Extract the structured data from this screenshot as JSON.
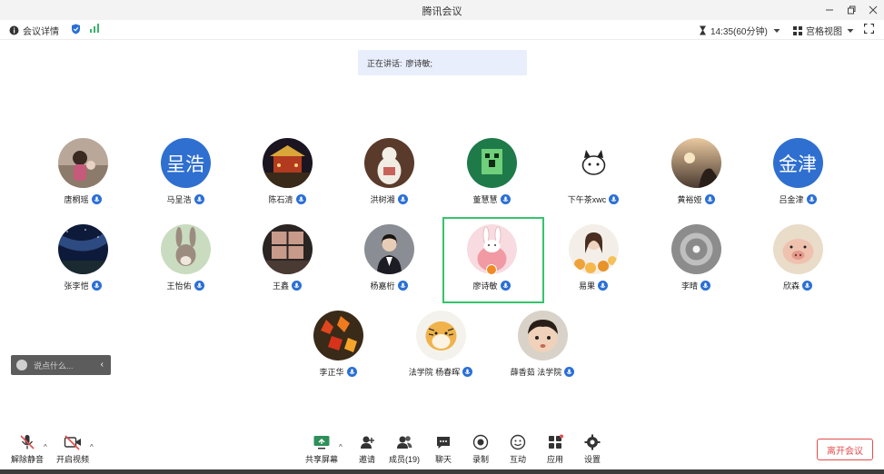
{
  "window": {
    "title": "腾讯会议"
  },
  "infobar": {
    "meeting_info": "会议详情",
    "time": "14:35(60分钟)",
    "view_mode": "宫格视图"
  },
  "speaking": {
    "label": "正在讲话:",
    "name": "廖诗敏;"
  },
  "participants": [
    {
      "name": "唐桐瑶",
      "avatar": "photo-child"
    },
    {
      "name": "马呈浩",
      "avatar": "text",
      "avatar_text": "呈浩",
      "avatar_color": "#2f6fd0"
    },
    {
      "name": "陈石清",
      "avatar": "photo-night-building"
    },
    {
      "name": "洪树湘",
      "avatar": "photo-figurine"
    },
    {
      "name": "董慧慧",
      "avatar": "minecraft-creeper"
    },
    {
      "name": "下午茶xwc",
      "avatar": "sketch-cat"
    },
    {
      "name": "黄裕娅",
      "avatar": "photo-sunset"
    },
    {
      "name": "吕金津",
      "avatar": "text",
      "avatar_text": "金津",
      "avatar_color": "#2f6fd0"
    },
    {
      "name": "张李恺",
      "avatar": "photo-starry-sky"
    },
    {
      "name": "王怡佑",
      "avatar": "cartoon-rabbit"
    },
    {
      "name": "王鑫",
      "avatar": "photo-window"
    },
    {
      "name": "杨嘉桁",
      "avatar": "photo-woman"
    },
    {
      "name": "廖诗敏",
      "avatar": "cartoon-bunny-peach",
      "is_host": true,
      "speaking": true
    },
    {
      "name": "易果",
      "avatar": "photo-girl-flowers"
    },
    {
      "name": "李晴",
      "avatar": "photo-moon-halo"
    },
    {
      "name": "欣森",
      "avatar": "photo-pig"
    },
    {
      "name": "李正华",
      "avatar": "photo-red-leaves"
    },
    {
      "name": "法学院 杨春晖",
      "avatar": "cartoon-tiger"
    },
    {
      "name": "薛香茹 法学院",
      "avatar": "photo-baby"
    }
  ],
  "chat": {
    "placeholder": "说点什么..."
  },
  "toolbar": {
    "unmute": "解除静音",
    "start_video": "开启视频",
    "share_screen": "共享屏幕",
    "invite": "邀请",
    "members": "成员(19)",
    "chat": "聊天",
    "record": "录制",
    "interact": "互动",
    "apps": "应用",
    "settings": "设置",
    "leave": "离开会议"
  },
  "colors": {
    "accent": "#2a6fd6",
    "speaking_frame": "#35c46a",
    "leave": "#e34d4d",
    "host_badge": "#f08a24"
  }
}
